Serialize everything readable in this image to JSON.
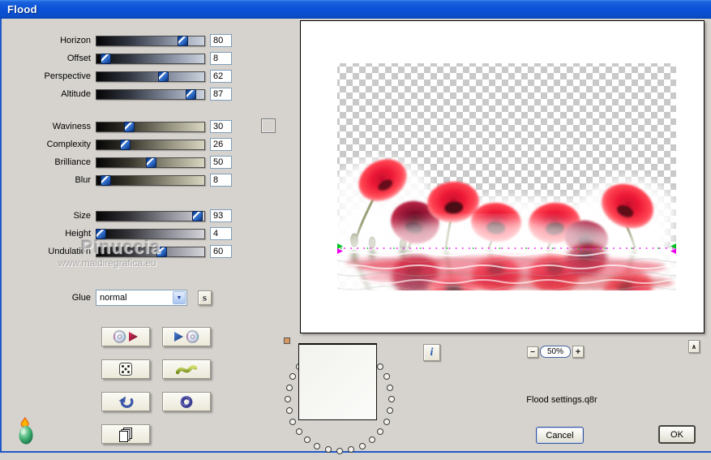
{
  "window": {
    "title": "Flood"
  },
  "slider_groups": [
    {
      "name": "view",
      "rows": [
        {
          "label": "Horizon",
          "value": 80
        },
        {
          "label": "Offset",
          "value": 8
        },
        {
          "label": "Perspective",
          "value": 62
        },
        {
          "label": "Altitude",
          "value": 87
        }
      ]
    },
    {
      "name": "water",
      "rows": [
        {
          "label": "Waviness",
          "value": 30
        },
        {
          "label": "Complexity",
          "value": 26
        },
        {
          "label": "Brilliance",
          "value": 50
        },
        {
          "label": "Blur",
          "value": 8
        }
      ]
    },
    {
      "name": "ripple",
      "rows": [
        {
          "label": "Size",
          "value": 93
        },
        {
          "label": "Height",
          "value": 4
        },
        {
          "label": "Undulation",
          "value": 60
        }
      ]
    }
  ],
  "glue": {
    "label": "Glue",
    "value": "normal",
    "s_button_label": "s"
  },
  "color_swatch": {
    "color": "#000000"
  },
  "tool_icons": {
    "save": "cd-disc-with-red-play-arrow-icon",
    "load": "blue-play-arrow-with-cd-disc-icon",
    "random": "dice-icon",
    "wave": "green-wave-icon",
    "undo": "blue-undo-arrow-icon",
    "ring": "blue-ring-icon",
    "copy": "stacked-pages-icon",
    "logo": "flaming-pear-icon"
  },
  "preview": {
    "zoom_out_label": "−",
    "zoom_value": "50%",
    "zoom_in_label": "+",
    "info_label": "i",
    "scroll_up_label": "∧",
    "settings_filename": "Flood settings.q8r",
    "memory_dots_count": 28
  },
  "action_buttons": {
    "cancel": "Cancel",
    "ok": "OK"
  },
  "watermark": {
    "name": "Pinuccia",
    "url": "www.maidiregrafica.eu"
  },
  "colors": {
    "titlebar_blue": "#0b52d8",
    "body_bg": "#d6d3ce",
    "checker_gray": "#c9c9c9",
    "poppy_red": "#ee1a36",
    "poppy_dark_red": "#8f1232",
    "stem_green": "#8a8f62",
    "horizon_magenta": "#ee00ee",
    "horizon_green": "#00c020",
    "memory_dot_orange": "#d89860",
    "input_border": "#7f9db9"
  }
}
